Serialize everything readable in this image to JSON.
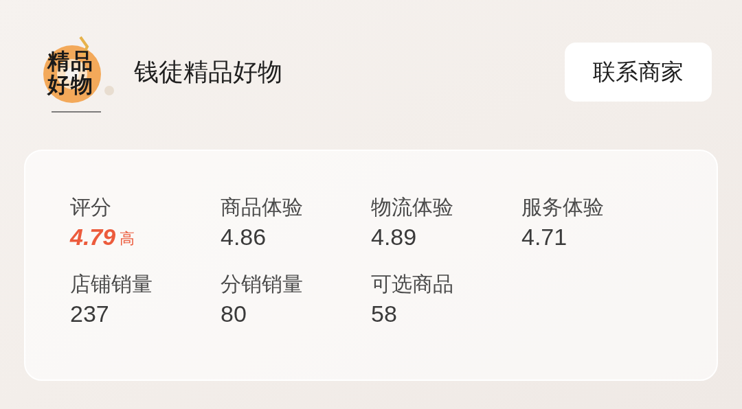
{
  "store": {
    "logo_lines": [
      "精品",
      "好物"
    ],
    "name": "钱徒精品好物",
    "contact_button": "联系商家"
  },
  "stats": [
    {
      "label": "评分",
      "value": "4.79",
      "badge": "高",
      "highlight": true
    },
    {
      "label": "商品体验",
      "value": "4.86",
      "highlight": false
    },
    {
      "label": "物流体验",
      "value": "4.89",
      "highlight": false
    },
    {
      "label": "服务体验",
      "value": "4.71",
      "highlight": false
    },
    {
      "label": "店铺销量",
      "value": "237",
      "highlight": false
    },
    {
      "label": "分销销量",
      "value": "80",
      "highlight": false
    },
    {
      "label": "可选商品",
      "value": "58",
      "highlight": false
    }
  ]
}
